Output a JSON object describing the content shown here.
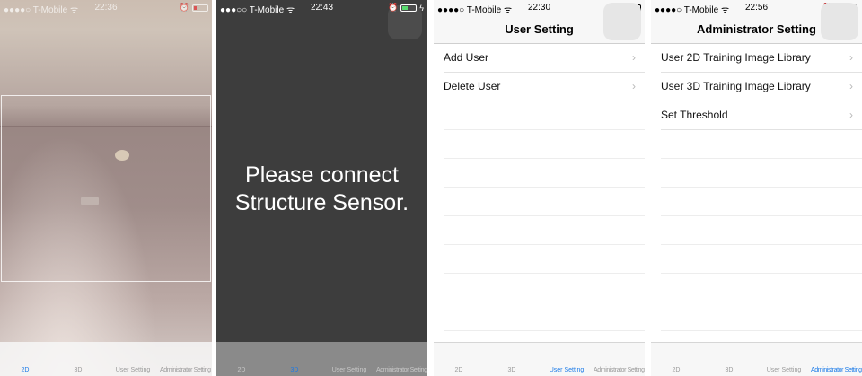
{
  "colors": {
    "accent": "#1a7ae8",
    "dark_bg": "#3d3d3d",
    "battery_red": "#e0262c",
    "battery_green": "#4cd964"
  },
  "tabs": [
    "2D",
    "3D",
    "User Setting",
    "Administrator Setting"
  ],
  "screens": [
    {
      "status": {
        "carrier": "●●●●○ T-Mobile",
        "time": "22:36"
      },
      "active_tab": 0
    },
    {
      "status": {
        "carrier": "●●●○○ T-Mobile",
        "time": "22:43"
      },
      "message_line1": "Please connect",
      "message_line2": "Structure Sensor.",
      "active_tab": 1
    },
    {
      "status": {
        "carrier": "●●●●○ T-Mobile",
        "time": "22:30"
      },
      "title": "User Setting",
      "items": [
        {
          "label": "Add User"
        },
        {
          "label": "Delete User"
        }
      ],
      "active_tab": 2
    },
    {
      "status": {
        "carrier": "●●●●○ T-Mobile",
        "time": "22:56"
      },
      "title": "Administrator Setting",
      "items": [
        {
          "label": "User 2D Training Image Library"
        },
        {
          "label": "User 3D Training Image Library"
        },
        {
          "label": "Set Threshold"
        }
      ],
      "active_tab": 3
    }
  ],
  "icons": {
    "wifi": "wifi-icon",
    "alarm": "alarm-icon",
    "battery": "battery-icon",
    "chevron": "chevron-right-icon",
    "charging": "charging-icon"
  },
  "glyphs": {
    "wifi": "ᯤ",
    "alarm": "⏰",
    "chevron": "›",
    "bolt": "ϟ"
  }
}
